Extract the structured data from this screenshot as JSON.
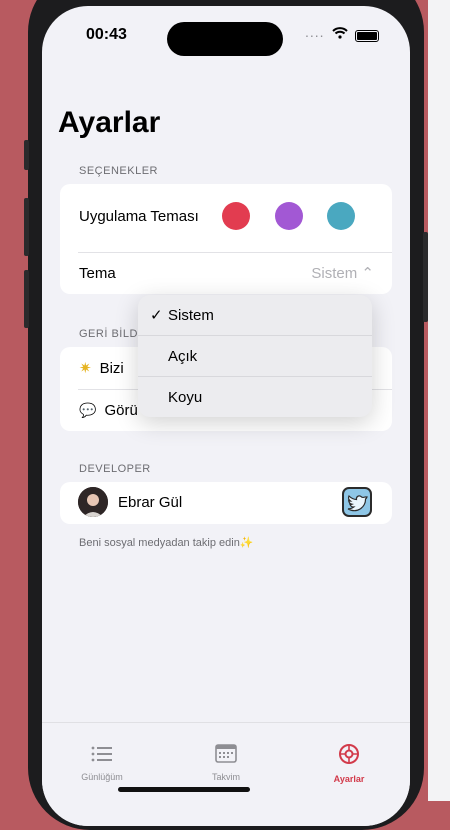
{
  "status_bar": {
    "time": "00:43",
    "signal": "....",
    "wifi": "wifi-icon",
    "battery": "battery-icon"
  },
  "page_title": "Ayarlar",
  "sections": {
    "options": {
      "header": "SEÇENEKLER",
      "app_theme_label": "Uygulama Teması",
      "theme_colors": [
        "#e23c50",
        "#a258d4",
        "#4aa8c0"
      ],
      "tema_label": "Tema",
      "tema_value": "Sistem"
    },
    "feedback": {
      "header": "GERİ BİLD",
      "row1_icon": "star-icon",
      "row1_label": "Bizi",
      "row2_icon": "speech-bubble-icon",
      "row2_label": "Görü"
    },
    "developer": {
      "header": "DEVELOPER",
      "name": "Ebrar Gül",
      "footnote": "Beni sosyal medyadan takip edin✨"
    }
  },
  "theme_menu": {
    "items": [
      {
        "label": "Sistem",
        "selected": true,
        "check": "✓"
      },
      {
        "label": "Açık",
        "selected": false
      },
      {
        "label": "Koyu",
        "selected": false
      }
    ]
  },
  "tab_bar": {
    "tabs": [
      {
        "label": "Günlüğüm",
        "icon": "list-icon"
      },
      {
        "label": "Takvim",
        "icon": "calendar-icon"
      },
      {
        "label": "Ayarlar",
        "icon": "settings-gear-icon",
        "active": true
      }
    ],
    "active_color": "#d23a4a"
  }
}
